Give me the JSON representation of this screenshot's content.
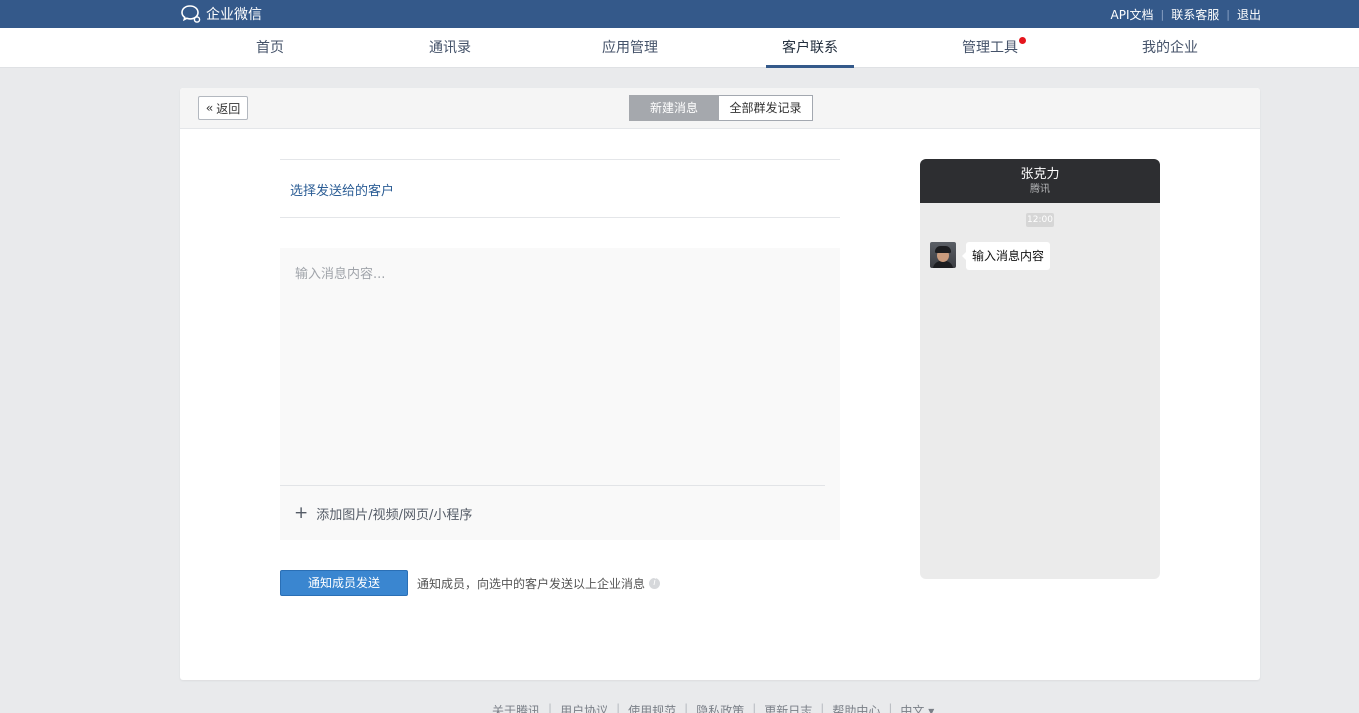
{
  "header": {
    "brand": "企业微信",
    "links": [
      "API文档",
      "联系客服",
      "退出"
    ]
  },
  "nav": {
    "items": [
      "首页",
      "通讯录",
      "应用管理",
      "客户联系",
      "管理工具",
      "我的企业"
    ],
    "active": "客户联系"
  },
  "toolbar": {
    "back_label": "返回",
    "tabs": [
      "新建消息",
      "全部群发记录"
    ],
    "active_tab": "新建消息"
  },
  "form": {
    "select_customers": "选择发送给的客户",
    "message_placeholder": "输入消息内容...",
    "add_media": "添加图片/视频/网页/小程序",
    "send_button": "通知成员发送",
    "send_tip": "通知成员，向选中的客户发送以上企业消息"
  },
  "preview": {
    "name": "张克力",
    "org": "腾讯",
    "time": "12:00",
    "message": "输入消息内容"
  },
  "footer": {
    "links": [
      "关于腾讯",
      "用户协议",
      "使用规范",
      "隐私政策",
      "更新日志",
      "帮助中心",
      "中文 ▾"
    ]
  },
  "colors": {
    "header_bg": "#34598a",
    "primary_button": "#3a86d0",
    "link": "#2b5d95",
    "badge_red": "#e5151d"
  }
}
